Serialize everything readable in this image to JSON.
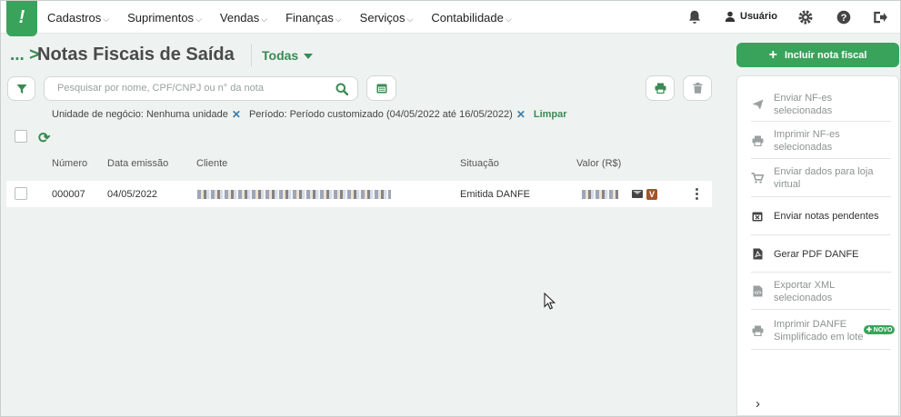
{
  "nav": {
    "logo": "!",
    "menu": [
      {
        "label": "Cadastros"
      },
      {
        "label": "Suprimentos"
      },
      {
        "label": "Vendas"
      },
      {
        "label": "Finanças"
      },
      {
        "label": "Serviços"
      },
      {
        "label": "Contabilidade"
      }
    ],
    "user_label": "Usuário"
  },
  "header": {
    "breadcrumb": "... >",
    "title": "Notas Fiscais de Saída",
    "filter_label": "Todas"
  },
  "search": {
    "placeholder": "Pesquisar por nome, CPF/CNPJ ou n° da nota"
  },
  "filters": {
    "chip1": "Unidade de negócio: Nenhuma unidade",
    "chip2": "Período: Período customizado (04/05/2022 até 16/05/2022)",
    "close": "✕",
    "clear_label": "Limpar"
  },
  "table": {
    "refresh": "⟳",
    "columns": {
      "numero": "Número",
      "data": "Data emissão",
      "cliente": "Cliente",
      "situacao": "Situação",
      "valor": "Valor (R$)"
    },
    "rows": [
      {
        "numero": "000007",
        "data": "04/05/2022",
        "situacao": "Emitida DANFE",
        "badge": "V"
      }
    ]
  },
  "sidebar": {
    "primary_button": "Incluir nota fiscal",
    "plus": "+",
    "actions": [
      {
        "label": "Enviar NF-es selecionadas",
        "icon": "send-icon",
        "enabled": false
      },
      {
        "label": "Imprimir NF-es selecionadas",
        "icon": "print-icon",
        "enabled": false
      },
      {
        "label": "Enviar dados para loja virtual",
        "icon": "cart-icon",
        "enabled": false
      },
      {
        "label": "Enviar notas pendentes",
        "icon": "calendar-x-icon",
        "enabled": true
      },
      {
        "label": "Gerar PDF DANFE",
        "icon": "pdf-icon",
        "enabled": true
      },
      {
        "label": "Exportar XML selecionados",
        "icon": "xml-file-icon",
        "enabled": false
      },
      {
        "label": "Imprimir DANFE Simplificado em lote",
        "icon": "print-icon",
        "enabled": false
      }
    ],
    "novo_badge": "✚ NOVO",
    "expand": "›"
  },
  "colors": {
    "primary": "#3aa35b",
    "link": "#3a8a53",
    "background": "#eef3f1"
  }
}
